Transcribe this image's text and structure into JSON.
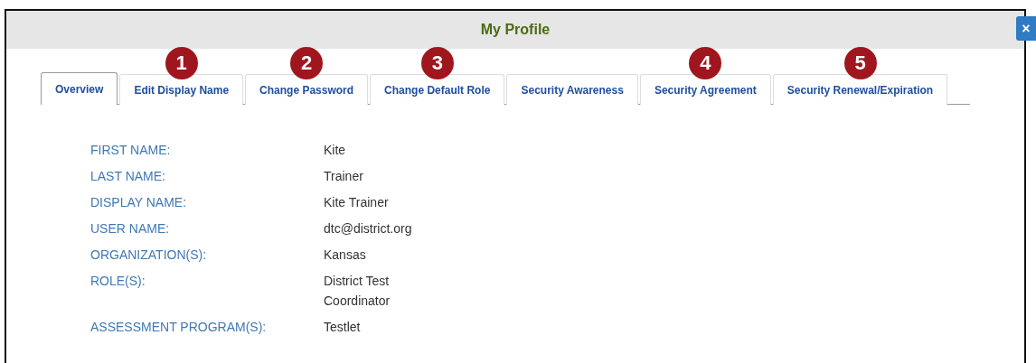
{
  "window": {
    "title": "My Profile",
    "close": "×"
  },
  "tabs": [
    {
      "label": "Overview",
      "selected": true
    },
    {
      "label": "Edit Display Name",
      "selected": false,
      "badge": "1"
    },
    {
      "label": "Change Password",
      "selected": false,
      "badge": "2"
    },
    {
      "label": "Change Default Role",
      "selected": false,
      "badge": "3"
    },
    {
      "label": "Security Awareness",
      "selected": false
    },
    {
      "label": "Security Agreement",
      "selected": false,
      "badge": "4"
    },
    {
      "label": "Security Renewal/Expiration",
      "selected": false,
      "badge": "5"
    }
  ],
  "fields": [
    {
      "label": "FIRST NAME:",
      "value": [
        "Kite"
      ]
    },
    {
      "label": "LAST NAME:",
      "value": [
        "Trainer"
      ]
    },
    {
      "label": "DISPLAY NAME:",
      "value": [
        "Kite Trainer"
      ]
    },
    {
      "label": "USER NAME:",
      "value": [
        "dtc@district.org"
      ]
    },
    {
      "label": "ORGANIZATION(S):",
      "value": [
        "Kansas"
      ]
    },
    {
      "label": "ROLE(S):",
      "value": [
        "District Test",
        "Coordinator"
      ]
    },
    {
      "label": "ASSESSMENT PROGRAM(S):",
      "value": [
        "Testlet"
      ]
    }
  ]
}
